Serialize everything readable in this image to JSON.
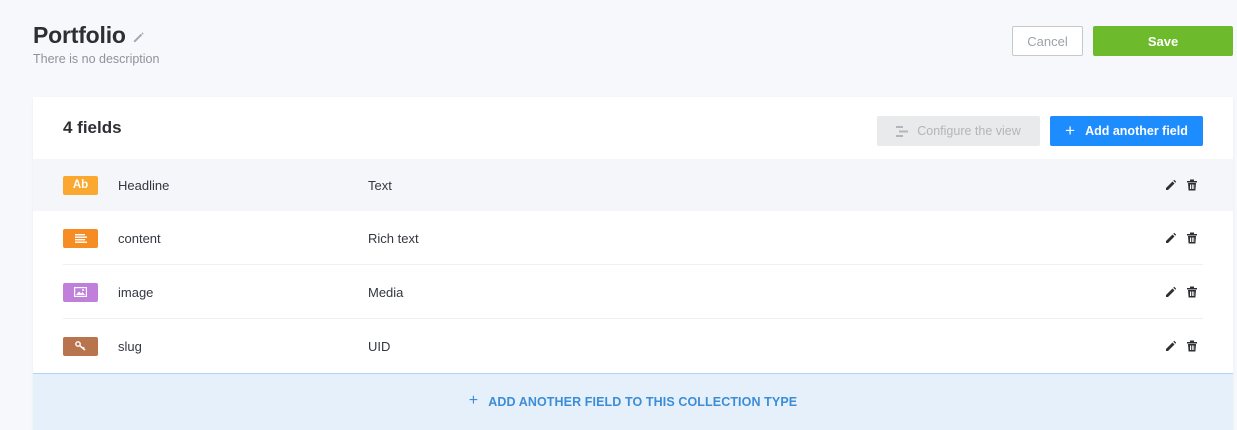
{
  "header": {
    "title": "Portfolio",
    "description": "There is no description",
    "cancel_label": "Cancel",
    "save_label": "Save"
  },
  "colors": {
    "save": "#6dbb2c",
    "primary": "#1c8cff"
  },
  "card": {
    "fields_count": "4 fields",
    "configure_label": "Configure the view",
    "add_field_label": "Add another field",
    "add_to_type_label": "ADD ANOTHER FIELD TO THIS COLLECTION TYPE"
  },
  "fields": [
    {
      "name": "Headline",
      "type": "Text",
      "icon": "text-ab-icon",
      "badge_text": "Ab",
      "badge_color": "#faa82f"
    },
    {
      "name": "content",
      "type": "Rich text",
      "icon": "richtext-lines-icon",
      "badge_text": "",
      "badge_color": "#f68d24"
    },
    {
      "name": "image",
      "type": "Media",
      "icon": "media-image-icon",
      "badge_text": "",
      "badge_color": "#c07fdb"
    },
    {
      "name": "slug",
      "type": "UID",
      "icon": "uid-key-icon",
      "badge_text": "",
      "badge_color": "#b8744d"
    }
  ]
}
